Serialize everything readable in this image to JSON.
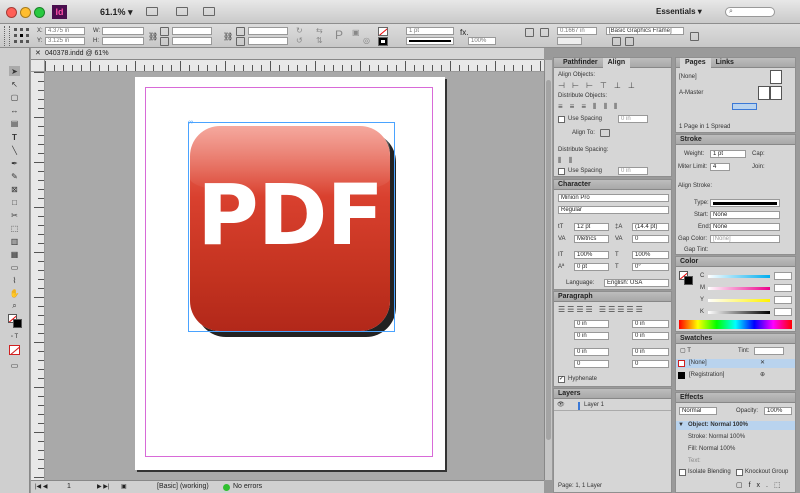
{
  "menubar": {
    "app_logo": "Id",
    "zoom": "61.1%",
    "workspace": "Essentials",
    "colors": {
      "close": "#ff5f57",
      "minimize": "#ffbd2e",
      "zoom": "#28c940",
      "logo_bg": "#4a0e4e",
      "logo_fg": "#ff4fa7"
    }
  },
  "control": {
    "x_label": "X:",
    "x_value": "4.375 in",
    "y_label": "Y:",
    "y_value": "3.125 in",
    "w_label": "W:",
    "h_label": "H:",
    "stroke_weight": "1 pt",
    "opacity": "100%",
    "ref_value": "0.1667 in",
    "object_style": "[Basic Graphics Frame]"
  },
  "document": {
    "tab_title": "040378.indd @ 61%",
    "pdf_label": "PDF"
  },
  "status": {
    "page": "1",
    "style": "[Basic] (working)",
    "errors": "No errors"
  },
  "align": {
    "tab_pathfinder": "Pathfinder",
    "tab_align": "Align",
    "align_objects": "Align Objects:",
    "distribute_objects": "Distribute Objects:",
    "use_spacing": "Use Spacing",
    "spacing_value": "0 in",
    "align_to": "Align To:",
    "distribute_spacing": "Distribute Spacing:"
  },
  "character": {
    "title": "Character",
    "font": "Minion Pro",
    "style": "Regular",
    "size": "12 pt",
    "leading": "(14.4 pt)",
    "kerning": "Metrics",
    "tracking": "0",
    "vscale": "100%",
    "hscale": "100%",
    "baseline": "0 pt",
    "skew": "0°",
    "language_label": "Language:",
    "language": "English: USA"
  },
  "paragraph": {
    "title": "Paragraph",
    "indent": "0 in",
    "space": "0",
    "hyphenate": "Hyphenate"
  },
  "layers": {
    "title": "Layers",
    "layer1": "Layer 1",
    "footer": "Page: 1, 1 Layer"
  },
  "pages": {
    "tab_pages": "Pages",
    "tab_links": "Links",
    "none": "[None]",
    "master": "A-Master",
    "footer": "1 Page in 1 Spread"
  },
  "stroke": {
    "title": "Stroke",
    "weight_label": "Weight:",
    "weight": "1 pt",
    "cap_label": "Cap:",
    "miter_label": "Miter Limit:",
    "miter": "4",
    "join_label": "Join:",
    "align_label": "Align Stroke:",
    "type_label": "Type:",
    "start_label": "Start:",
    "start": "None",
    "end_label": "End:",
    "end": "None",
    "gap_color_label": "Gap Color:",
    "gap_color": "[None]",
    "gap_tint_label": "Gap Tint:"
  },
  "color": {
    "title": "Color",
    "c": "C",
    "m": "M",
    "y": "Y",
    "k": "K"
  },
  "swatches": {
    "title": "Swatches",
    "tint_label": "Tint:",
    "none": "[None]",
    "registration": "[Registration]"
  },
  "effects": {
    "title": "Effects",
    "mode": "Normal",
    "opacity_label": "Opacity:",
    "opacity": "100%",
    "object_row": "Object: Normal 100%",
    "stroke_row": "Stroke: Normal 100%",
    "fill_row": "Fill: Normal 100%",
    "text_row": "Text:",
    "isolate": "Isolate Blending",
    "knockout": "Knockout Group"
  }
}
